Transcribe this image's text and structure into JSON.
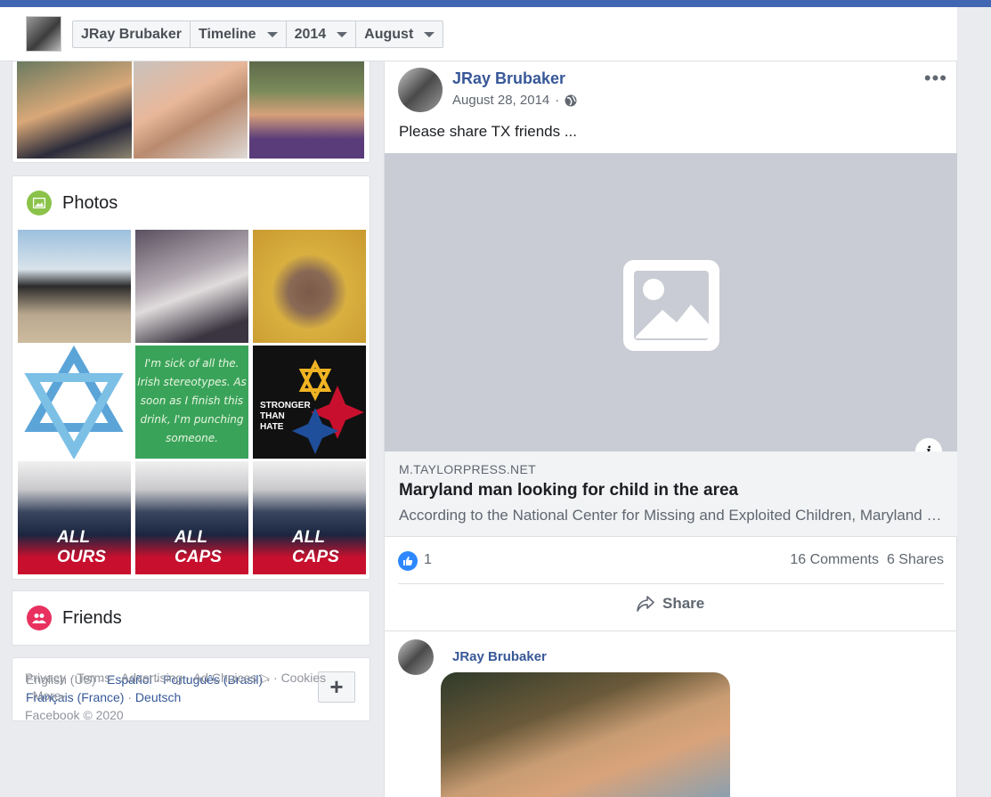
{
  "header": {
    "crumbs": [
      {
        "label": "JRay Brubaker",
        "dropdown": false
      },
      {
        "label": "Timeline",
        "dropdown": true
      },
      {
        "label": "2014",
        "dropdown": true
      },
      {
        "label": "August",
        "dropdown": true
      }
    ]
  },
  "photos": {
    "title": "Photos"
  },
  "photo_tiles": [
    {
      "text": ""
    },
    {
      "text": ""
    },
    {
      "text": ""
    },
    {
      "text": ""
    },
    {
      "text": "I'm sick of all the. Irish stereotypes. As soon as I finish this drink, I'm punching someone."
    },
    {
      "text": "STRONGER THAN HATE"
    },
    {
      "text": "ALL OURS"
    },
    {
      "text": "ALL CAPS"
    },
    {
      "text": "ALL CAPS"
    }
  ],
  "friends": {
    "title": "Friends"
  },
  "languages": {
    "current": "English (US)",
    "others": [
      "Español",
      "Português (Brasil)",
      "Français (France)",
      "Deutsch"
    ],
    "add_label": "+"
  },
  "footer": {
    "links": [
      "Privacy",
      "Terms",
      "Advertising",
      "Ad Choices",
      "Cookies",
      "More"
    ],
    "copyright": "Facebook © 2020"
  },
  "post": {
    "author": "JRay Brubaker",
    "date": "August 28, 2014",
    "text": "Please share TX friends ...",
    "link": {
      "domain": "M.TAYLORPRESS.NET",
      "title": "Maryland man looking for child in the area",
      "description": "According to the National Center for Missing and Exploited Children, Maryland man looking for child in the area"
    },
    "likes": "1",
    "comments": "16 Comments",
    "shares": "6 Shares",
    "share_label": "Share"
  },
  "post2": {
    "author": "JRay Brubaker"
  },
  "colors": {
    "brand": "#4267b2",
    "link": "#385898",
    "like": "#2d88ff"
  }
}
